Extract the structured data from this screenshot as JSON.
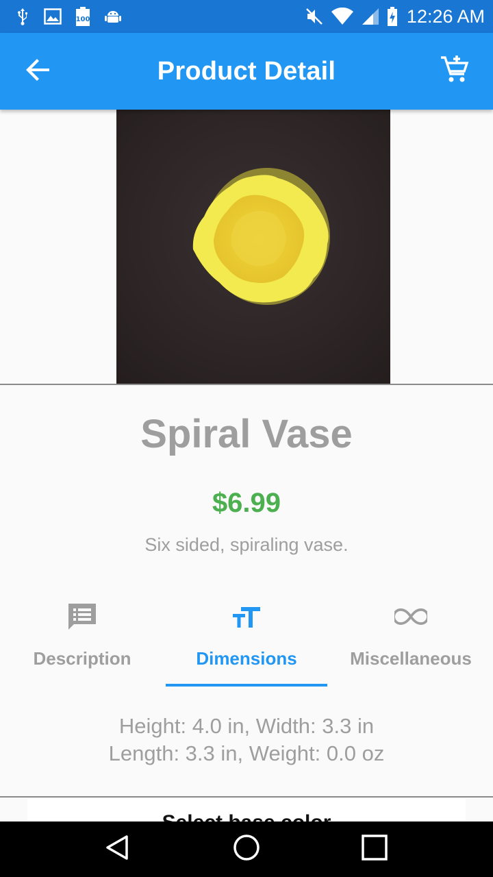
{
  "status_bar": {
    "time": "12:26 AM",
    "left_icons": [
      "usb-icon",
      "image-icon",
      "battery-100-icon",
      "android-icon"
    ],
    "right_icons": [
      "mute-icon",
      "wifi-icon",
      "signal-icon",
      "battery-charging-icon"
    ]
  },
  "app_bar": {
    "title": "Product Detail",
    "back_icon": "arrow-back-icon",
    "cart_icon": "add-shopping-cart-icon"
  },
  "product": {
    "name": "Spiral Vase",
    "price": "$6.99",
    "description": "Six sided, spiraling vase."
  },
  "tabs": [
    {
      "label": "Description",
      "icon": "message-icon",
      "active": false
    },
    {
      "label": "Dimensions",
      "icon": "text-size-icon",
      "active": true
    },
    {
      "label": "Miscellaneous",
      "icon": "infinity-icon",
      "active": false
    }
  ],
  "dimensions": {
    "line1": "Height: 4.0 in, Width: 3.3 in",
    "line2": "Length: 3.3 in, Weight: 0.0 oz"
  },
  "color_section": {
    "title": "Select base color"
  },
  "colors": {
    "status_bar": "#1976d2",
    "app_bar": "#2196f3",
    "accent": "#2196f3",
    "price": "#4caf50",
    "muted_text": "#9e9e9e"
  }
}
